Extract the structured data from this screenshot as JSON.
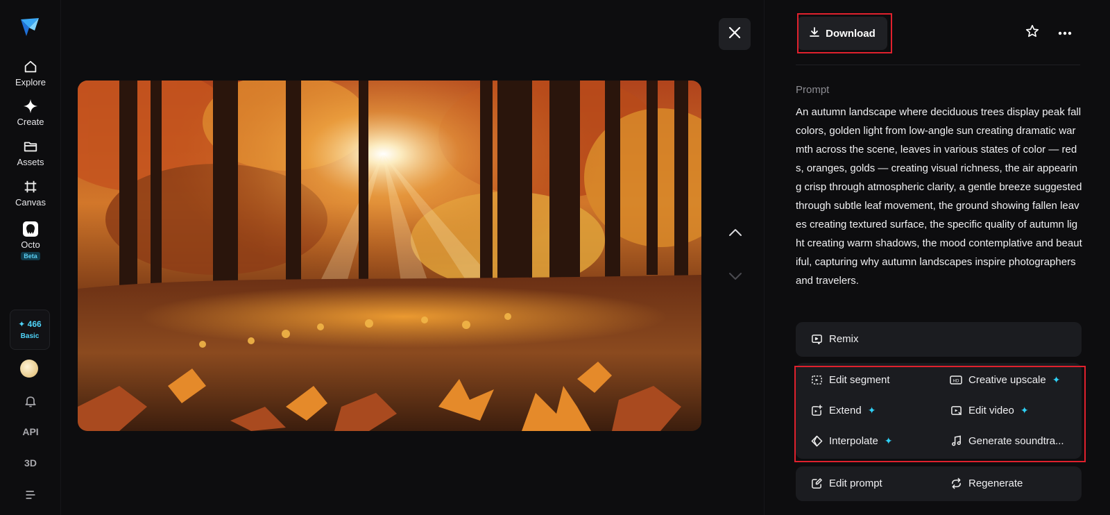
{
  "sidebar": {
    "items": [
      {
        "label": "Explore",
        "icon": "home-icon"
      },
      {
        "label": "Create",
        "icon": "sparkle-icon"
      },
      {
        "label": "Assets",
        "icon": "folder-icon"
      },
      {
        "label": "Canvas",
        "icon": "crop-grid-icon"
      },
      {
        "label": "Octo",
        "icon": "octo-icon",
        "badge": "Beta"
      }
    ],
    "credits": {
      "amount": "✦ 466",
      "plan": "Basic"
    },
    "api_label": "API",
    "three_d_label": "3D"
  },
  "toolbar": {
    "download_label": "Download"
  },
  "prompt": {
    "label": "Prompt",
    "text": "An autumn landscape where deciduous trees display peak fall colors, golden light from low-angle sun creating dramatic warmth across the scene, leaves in various states of color — reds, oranges, golds — creating visual richness, the air appearing crisp through atmospheric clarity, a gentle breeze suggested through subtle leaf movement, the ground showing fallen leaves creating textured surface, the specific quality of autumn light creating warm shadows, the mood contemplative and beautiful, capturing why autumn landscapes inspire photographers and travelers."
  },
  "actions": {
    "remix": "Remix",
    "edit_segment": "Edit segment",
    "creative_upscale": "Creative upscale",
    "extend": "Extend",
    "edit_video": "Edit video",
    "interpolate": "Interpolate",
    "generate_soundtrack": "Generate soundtra...",
    "edit_prompt": "Edit prompt",
    "regenerate": "Regenerate",
    "spark": "✦"
  },
  "colors": {
    "background": "#0d0d0f",
    "card": "#1b1c20",
    "accent": "#2fd0f5",
    "highlight": "#e0212d"
  }
}
